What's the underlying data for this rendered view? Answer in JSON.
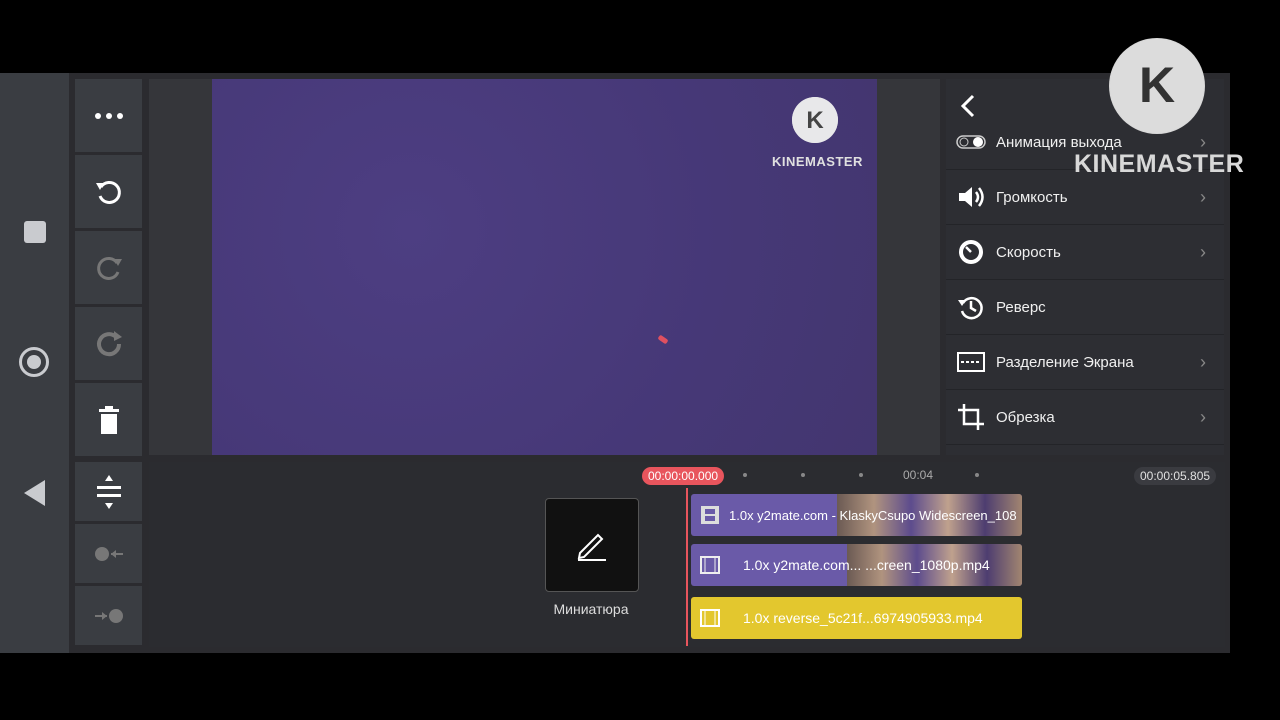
{
  "toolbar": {
    "icons": [
      "more-icon",
      "undo-icon",
      "redo-icon",
      "restore-icon",
      "delete-icon",
      "split-icon",
      "record-left-icon",
      "record-right-icon"
    ]
  },
  "preview": {
    "watermark_text": "KINEMASTER",
    "bg_color": "#4a3a7d"
  },
  "corner_watermark": {
    "text": "KINEMASTER"
  },
  "panel": {
    "items": [
      {
        "label": "Анимация выхода",
        "icon": "toggle-icon"
      },
      {
        "label": "Громкость",
        "icon": "volume-icon"
      },
      {
        "label": "Скорость",
        "icon": "speed-icon"
      },
      {
        "label": "Реверс",
        "icon": "history-icon"
      },
      {
        "label": "Разделение Экрана",
        "icon": "split-screen-icon"
      },
      {
        "label": "Обрезка",
        "icon": "crop-icon"
      }
    ]
  },
  "timeline": {
    "current_time": "00:00:00.000",
    "tick_label": "00:04",
    "total_time": "00:00:05.805",
    "thumbnail_label": "Миниатюра",
    "clips": [
      {
        "label": "1.0x y2mate.com - KlaskyCsupo Widescreen_108",
        "color": "#6a5aa8"
      },
      {
        "label": "1.0x y2mate.com... ...creen_1080p.mp4",
        "color": "#6a5aa8"
      },
      {
        "label": "1.0x reverse_5c21f...6974905933.mp4",
        "color": "#e3c72e"
      }
    ]
  }
}
